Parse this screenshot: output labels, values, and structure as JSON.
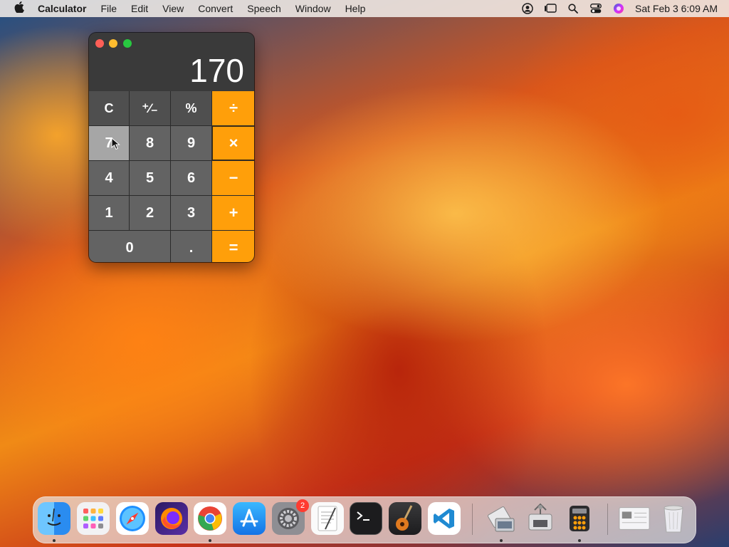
{
  "menubar": {
    "app_name": "Calculator",
    "menus": [
      "File",
      "Edit",
      "View",
      "Convert",
      "Speech",
      "Window",
      "Help"
    ],
    "clock": "Sat Feb 3  6:09 AM"
  },
  "calculator": {
    "display": "170",
    "keys": {
      "clear": "C",
      "sign": "⁺∕₋",
      "percent": "%",
      "divide": "÷",
      "seven": "7",
      "eight": "8",
      "nine": "9",
      "multiply": "×",
      "four": "4",
      "five": "5",
      "six": "6",
      "minus": "−",
      "one": "1",
      "two": "2",
      "three": "3",
      "plus": "+",
      "zero": "0",
      "decimal": ".",
      "equals": "="
    }
  },
  "dock": {
    "system_settings_badge": "2"
  },
  "colors": {
    "operator": "#ff9f0a",
    "digit_key": "#636363",
    "function_key": "#4f4f4f"
  }
}
